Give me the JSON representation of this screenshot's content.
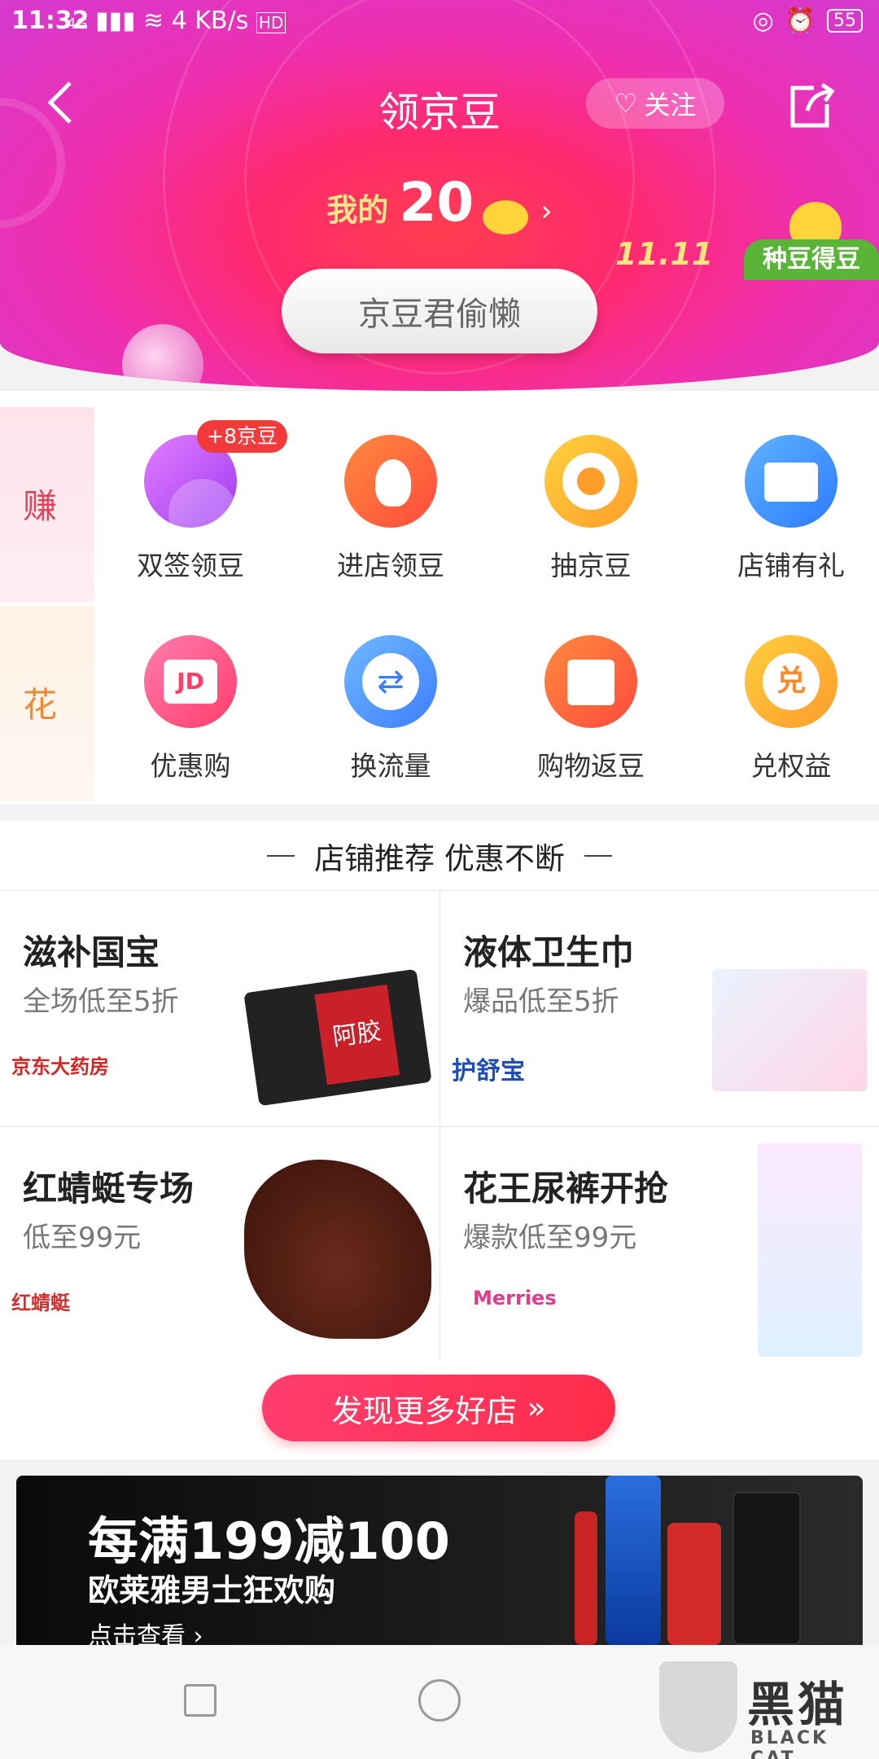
{
  "status_bar": {
    "time": "11:32",
    "network": "4G",
    "speed": "4 KB/s",
    "hd": "HD",
    "battery": "55"
  },
  "header": {
    "title": "领京豆",
    "follow_label": "关注"
  },
  "beans": {
    "label": "我的",
    "count": "20"
  },
  "promo": {
    "tag": "11.11",
    "plant_label": "种豆得豆"
  },
  "lazy_button": "京豆君偷懒",
  "sections": {
    "earn": "赚",
    "spend": "花"
  },
  "earn_items": [
    {
      "label": "双签领豆",
      "badge": "+8京豆"
    },
    {
      "label": "进店领豆"
    },
    {
      "label": "抽京豆"
    },
    {
      "label": "店铺有礼"
    }
  ],
  "spend_items": [
    {
      "label": "优惠购",
      "icon_text": "JD"
    },
    {
      "label": "换流量"
    },
    {
      "label": "购物返豆"
    },
    {
      "label": "兑权益",
      "icon_text": "兑"
    }
  ],
  "recommend": {
    "heading": "店铺推荐 优惠不断",
    "shops": [
      {
        "title": "滋补国宝",
        "subtitle": "全场低至5折",
        "brand": "京东大药房",
        "product_text": "阿胶"
      },
      {
        "title": "液体卫生巾",
        "subtitle": "爆品低至5折",
        "brand": "护舒宝"
      },
      {
        "title": "红蜻蜓专场",
        "subtitle": "低至99元",
        "brand": "红蜻蜓"
      },
      {
        "title": "花王尿裤开抢",
        "subtitle": "爆款低至99元",
        "brand": "Merries"
      }
    ],
    "more_button": "发现更多好店"
  },
  "ad": {
    "headline": "每满199减100",
    "subline": "欧莱雅男士狂欢购",
    "cta": "点击查看"
  },
  "watermark": {
    "cn": "黑猫",
    "en": "BLACK CAT"
  }
}
